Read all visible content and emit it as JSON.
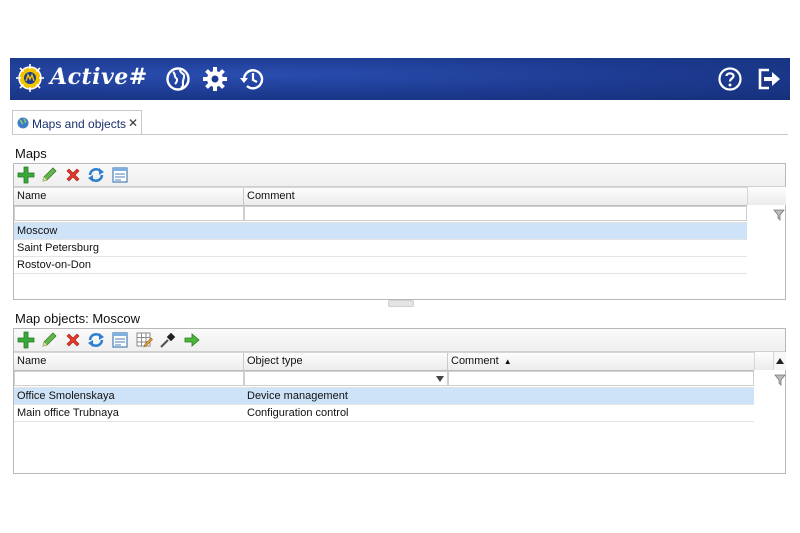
{
  "header": {
    "app_title": "Active#",
    "colors": {
      "bar": "#1c3a8f",
      "icon": "#ffffff"
    },
    "icons_left": [
      "globe-icon",
      "gear-icon",
      "history-icon"
    ],
    "icons_right": [
      "help-icon",
      "logout-icon"
    ]
  },
  "tab": {
    "label": "Maps and objects",
    "close": "✕"
  },
  "maps": {
    "title": "Maps",
    "toolbar": [
      "add-icon",
      "edit-icon",
      "delete-icon",
      "refresh-icon",
      "export-icon"
    ],
    "columns": [
      "Name",
      "Comment"
    ],
    "rows": [
      {
        "name": "Moscow",
        "comment": ""
      },
      {
        "name": "Saint Petersburg",
        "comment": ""
      },
      {
        "name": "Rostov-on-Don",
        "comment": ""
      }
    ],
    "selected_row": 0
  },
  "objects": {
    "title": "Map objects: Moscow",
    "toolbar": [
      "add-icon",
      "edit-icon",
      "delete-icon",
      "refresh-icon",
      "export-icon",
      "grid-edit-icon",
      "pick-icon",
      "go-icon"
    ],
    "columns": [
      "Name",
      "Object type",
      "Comment"
    ],
    "sort_indicator": "▲",
    "rows": [
      {
        "name": "Office Smolenskaya",
        "type": "Device management",
        "comment": ""
      },
      {
        "name": "Main office Trubnaya",
        "type": "Configuration control",
        "comment": ""
      }
    ],
    "selected_row": 0
  }
}
